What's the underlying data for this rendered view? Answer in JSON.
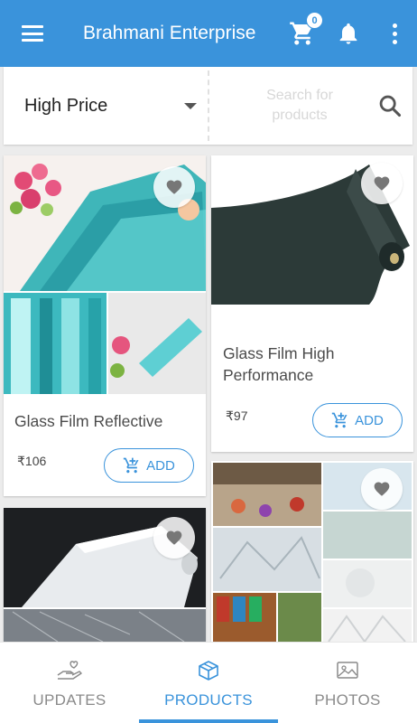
{
  "app_bar": {
    "title": "Brahmani Enterprise",
    "cart_count": "0",
    "icons": [
      "menu-icon",
      "cart-icon",
      "bell-icon",
      "more-vert-icon"
    ]
  },
  "filter": {
    "sort_value": "High Price",
    "search_placeholder": "Search for products",
    "search_value": ""
  },
  "products": [
    {
      "name": "Glass Film Reflective",
      "price": "₹106",
      "add_label": "ADD",
      "image": "teal reflective glass film rolls with flowers"
    },
    {
      "name": "Glass Film High Performance",
      "price": "₹97",
      "add_label": "ADD",
      "image": "dark tinted glass film roll"
    },
    {
      "name": "",
      "price": "",
      "add_label": "",
      "image": "clear glass film roll and shattered glass"
    },
    {
      "name": "",
      "price": "",
      "add_label": "",
      "image": "decorative frosted and floral window films collage"
    }
  ],
  "bottom_nav": {
    "items": [
      {
        "label": "UPDATES",
        "icon": "hand-heart-icon",
        "active": false
      },
      {
        "label": "PRODUCTS",
        "icon": "box-icon",
        "active": true
      },
      {
        "label": "PHOTOS",
        "icon": "photo-icon",
        "active": false
      }
    ]
  },
  "colors": {
    "primary": "#3a93db",
    "background": "#ececec"
  }
}
